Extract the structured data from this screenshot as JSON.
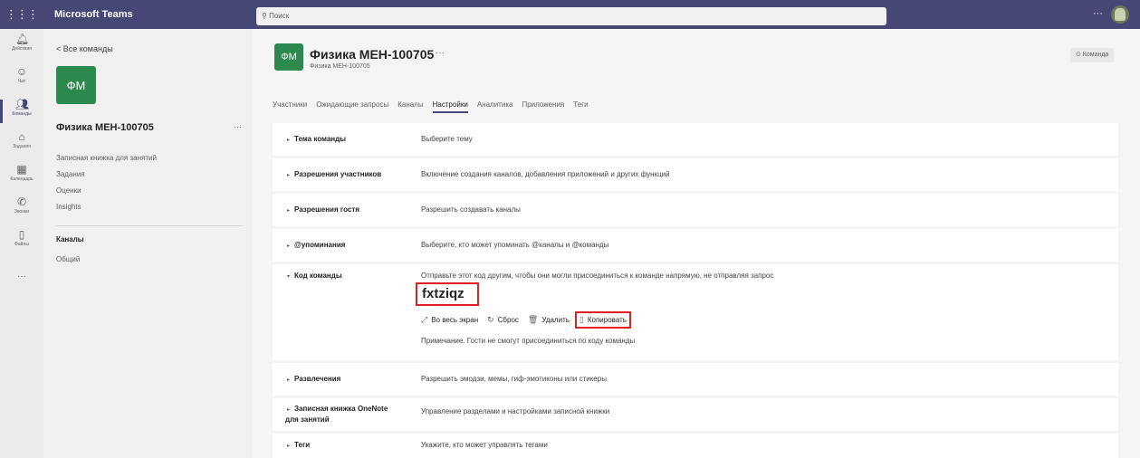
{
  "topbar": {
    "app_name": "Microsoft Teams",
    "search_placeholder": "Поиск",
    "more": "···"
  },
  "rail": [
    {
      "label": "Действия",
      "icon": "bell-icon",
      "glyph": "🔔︎"
    },
    {
      "label": "Чат",
      "icon": "chat-icon",
      "glyph": "☺"
    },
    {
      "label": "Команды",
      "icon": "teams-icon",
      "glyph": "👥︎"
    },
    {
      "label": "Задания",
      "icon": "assignments-icon",
      "glyph": "⌂"
    },
    {
      "label": "Календарь",
      "icon": "calendar-icon",
      "glyph": "▦"
    },
    {
      "label": "Звонки",
      "icon": "phone-icon",
      "glyph": "✆"
    },
    {
      "label": "Файлы",
      "icon": "file-icon",
      "glyph": "▯"
    }
  ],
  "rail_more": "···",
  "leftpanel": {
    "back": "<  Все команды",
    "avatar": "ФМ",
    "team_name": "Физика МЕН-100705",
    "more": "···",
    "links": [
      "Записная книжка для занятий",
      "Задания",
      "Оценки",
      "Insights"
    ],
    "channels_header": "Каналы",
    "channel_general": "Общий"
  },
  "header": {
    "avatar": "ФМ",
    "title": "Физика МЕН-100705",
    "more": "···",
    "subtitle": "Физика МЕН-100705",
    "team_button": "⊙ Команда"
  },
  "tabs": [
    "Участники",
    "Ожидающие запросы",
    "Каналы",
    "Настройки",
    "Аналитика",
    "Приложения",
    "Теги"
  ],
  "active_tab": "Настройки",
  "settings": [
    {
      "label": "Тема команды",
      "desc": "Выберите тему"
    },
    {
      "label": "Разрешения участников",
      "desc": "Включение создания каналов, добавления приложений и других функций"
    },
    {
      "label": "Разрешения гостя",
      "desc": "Разрешить создавать каналы"
    },
    {
      "label": "@упоминания",
      "desc": "Выберите, кто может упоминать @каналы и @команды"
    },
    {
      "label": "Код команды",
      "desc": "Отправьте этот код другим, чтобы они могли присоединиться к команде напрямую, не отправляя запрос"
    },
    {
      "label": "Развлечения",
      "desc": "Разрешить эмодзи, мемы, гиф-эмотиконы или стикеры"
    },
    {
      "label": "Записная книжка OneNote",
      "label2": "для занятий",
      "desc": "Управление разделами и настройками записной книжки"
    },
    {
      "label": "Теги",
      "desc": "Укажите, кто может управлять тегами"
    }
  ],
  "team_code": {
    "code": "fxtziqz",
    "fullscreen": "Во весь экран",
    "reset": "Сброс",
    "delete": "Удалить",
    "copy": "Копировать",
    "note": "Примечание. Гости не смогут присоединиться по коду команды"
  },
  "colors": {
    "topbar": "#464775",
    "team_avatar": "#2d8a4e",
    "highlight": "#e02020"
  }
}
